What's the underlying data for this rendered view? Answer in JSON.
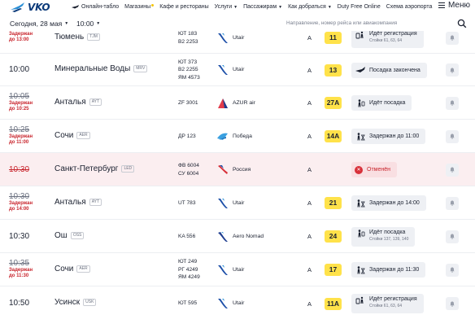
{
  "nav": {
    "logo_text": "VKO",
    "items": [
      {
        "label": "Онлайн-табло",
        "icon": "plane-icon"
      },
      {
        "label": "Магазины"
      },
      {
        "label": "Кафе и рестораны"
      },
      {
        "label": "Услуги"
      },
      {
        "label": "Пассажирам"
      },
      {
        "label": "Как добраться"
      },
      {
        "label": "Duty Free Online"
      },
      {
        "label": "Схема аэропорта"
      }
    ],
    "menu_label": "Меню"
  },
  "filters": {
    "date": "Сегодня, 28 мая",
    "time": "10:00",
    "search_placeholder": "Направление, номер рейса или авиакомпания"
  },
  "colors": {
    "gate_yellow": "#ffe24a",
    "delay_red": "#c8242c",
    "cancel_bg": "#fbeef0",
    "status_bg": "#eef0f4"
  },
  "flights": [
    {
      "time": "",
      "delay_1": "Задержан",
      "delay_2": "до 13:00",
      "city": "Тюмень",
      "code": "TJM",
      "flights": [
        "ЮТ 183",
        "B2 2253"
      ],
      "airline": "Utair",
      "airline_icon": "utair-icon",
      "terminal": "A",
      "gate": "11",
      "status": "Идёт регистрация",
      "status_sub": "Стойки 61, 63, 64",
      "status_icon": "checkin-icon"
    },
    {
      "time": "10:00",
      "delay_1": "",
      "delay_2": "",
      "city": "Минеральные Воды",
      "code": "MRV",
      "flights": [
        "ЮТ 373",
        "B2 2255",
        "ЯМ 4573"
      ],
      "airline": "Utair",
      "airline_icon": "utair-icon",
      "terminal": "A",
      "gate": "13",
      "status": "Посадка закончена",
      "status_sub": "",
      "status_icon": "plane-icon"
    },
    {
      "time": "10:05",
      "delay_1": "Задержан",
      "delay_2": "до 10:25",
      "city": "Анталья",
      "code": "AYT",
      "flights": [
        "ZF 3001"
      ],
      "airline": "AZUR air",
      "airline_icon": "azur-air-icon",
      "terminal": "A",
      "gate": "27А",
      "status": "Идёт посадка",
      "status_sub": "",
      "status_icon": "boarding-icon"
    },
    {
      "time": "10:25",
      "delay_1": "Задержан",
      "delay_2": "до 11:00",
      "city": "Сочи",
      "code": "AER",
      "flights": [
        "ДР 123"
      ],
      "airline": "Победа",
      "airline_icon": "pobeda-icon",
      "terminal": "A",
      "gate": "14А",
      "status": "Задержан до 11:00",
      "status_sub": "",
      "status_icon": "hourglass-icon"
    },
    {
      "time": "10:30",
      "delay_1": "",
      "delay_2": "",
      "city": "Санкт-Петербург",
      "code": "LED",
      "flights": [
        "ФВ 6004",
        "СУ 6004"
      ],
      "airline": "Россия",
      "airline_icon": "rossiya-icon",
      "terminal": "A",
      "gate": "",
      "status": "Отменён",
      "status_sub": "",
      "status_icon": "cancel-icon"
    },
    {
      "time": "10:30",
      "delay_1": "Задержан",
      "delay_2": "до 14:00",
      "city": "Анталья",
      "code": "AYT",
      "flights": [
        "UT 783"
      ],
      "airline": "Utair",
      "airline_icon": "utair-icon",
      "terminal": "A",
      "gate": "21",
      "status": "Задержан до 14:00",
      "status_sub": "",
      "status_icon": "hourglass-icon"
    },
    {
      "time": "10:30",
      "delay_1": "",
      "delay_2": "",
      "city": "Ош",
      "code": "OSS",
      "flights": [
        "KA 556"
      ],
      "airline": "Aero Nomad",
      "airline_icon": "aero-nomad-icon",
      "terminal": "A",
      "gate": "24",
      "status": "Идёт посадка",
      "status_sub": "Стойки 137, 139, 140",
      "status_icon": "boarding-icon"
    },
    {
      "time": "10:35",
      "delay_1": "Задержан",
      "delay_2": "до 11:30",
      "city": "Сочи",
      "code": "AER",
      "flights": [
        "ЮТ 249",
        "РГ 4249",
        "ЯМ 4249"
      ],
      "airline": "Utair",
      "airline_icon": "utair-icon",
      "terminal": "A",
      "gate": "17",
      "status": "Задержан до 11:30",
      "status_sub": "",
      "status_icon": "hourglass-icon"
    },
    {
      "time": "10:50",
      "delay_1": "",
      "delay_2": "",
      "city": "Усинск",
      "code": "USK",
      "flights": [
        "ЮТ 595"
      ],
      "airline": "Utair",
      "airline_icon": "utair-icon",
      "terminal": "A",
      "gate": "11А",
      "status": "Идёт регистрация",
      "status_sub": "Стойки 61, 63, 64",
      "status_icon": "checkin-icon"
    }
  ]
}
